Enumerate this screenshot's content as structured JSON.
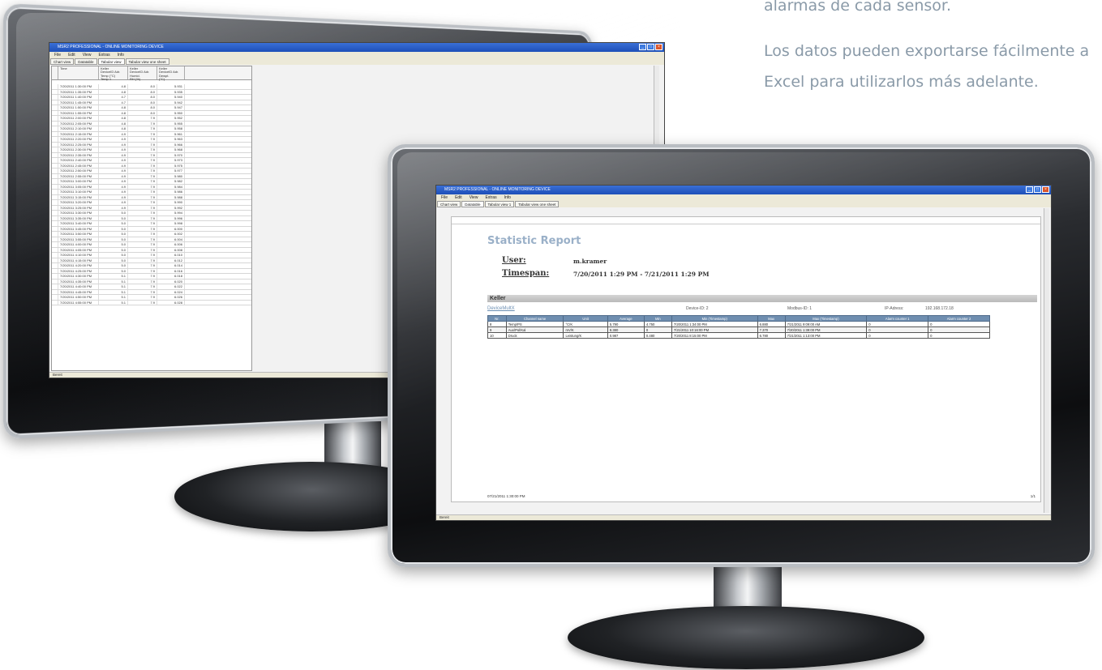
{
  "copy": {
    "line1": "alarmas de cada sensor.",
    "line2": "Los datos pueden exportarse fácilmente a",
    "line3": "Excel para utilizarlos más adelante."
  },
  "window": {
    "title": "MSR2 PROFESSIONAL - ONLINE MONITORING DEVICE",
    "menu": [
      "File",
      "Edit",
      "View",
      "Extras",
      "Info"
    ],
    "status": "Bereit"
  },
  "left_screen": {
    "tabs": [
      "Chart view",
      "Datatable",
      "Tabular view",
      "Tabular view one sheet"
    ],
    "active_tab": 2,
    "columns": [
      "Time",
      "Keller\nDeviceID Adr.\nTemp (°C)\nTemp 1",
      "Keller\nDeviceID Adr.\nHumid.\nRH (%)",
      "Keller\nDeviceID Adr.\nDewpt.\n(°C)"
    ],
    "rows": [
      [
        "7/20/2011 1:30:00 PM",
        "4.8",
        "8.0",
        "5.931"
      ],
      [
        "7/20/2011 1:35:00 PM",
        "4.8",
        "8.0",
        "5.935"
      ],
      [
        "7/20/2011 1:40:00 PM",
        "4.7",
        "8.0",
        "5.940"
      ],
      [
        "7/20/2011 1:45:00 PM",
        "4.7",
        "8.0",
        "5.942"
      ],
      [
        "7/20/2011 1:50:00 PM",
        "4.8",
        "8.0",
        "5.947"
      ],
      [
        "7/20/2011 1:55:00 PM",
        "4.8",
        "8.0",
        "5.950"
      ],
      [
        "7/20/2011 2:00:00 PM",
        "4.8",
        "7.9",
        "5.952"
      ],
      [
        "7/20/2011 2:05:00 PM",
        "4.8",
        "7.9",
        "5.955"
      ],
      [
        "7/20/2011 2:10:00 PM",
        "4.8",
        "7.9",
        "5.958"
      ],
      [
        "7/20/2011 2:15:00 PM",
        "4.9",
        "7.9",
        "5.961"
      ],
      [
        "7/20/2011 2:20:00 PM",
        "4.9",
        "7.9",
        "5.963"
      ],
      [
        "7/20/2011 2:25:00 PM",
        "4.9",
        "7.9",
        "5.966"
      ],
      [
        "7/20/2011 2:30:00 PM",
        "4.9",
        "7.9",
        "5.968"
      ],
      [
        "7/20/2011 2:35:00 PM",
        "4.9",
        "7.9",
        "5.970"
      ],
      [
        "7/20/2011 2:40:00 PM",
        "4.9",
        "7.9",
        "5.973"
      ],
      [
        "7/20/2011 2:45:00 PM",
        "4.9",
        "7.9",
        "5.975"
      ],
      [
        "7/20/2011 2:50:00 PM",
        "4.9",
        "7.9",
        "5.977"
      ],
      [
        "7/20/2011 2:55:00 PM",
        "4.9",
        "7.9",
        "5.980"
      ],
      [
        "7/20/2011 3:00:00 PM",
        "4.9",
        "7.9",
        "5.982"
      ],
      [
        "7/20/2011 3:05:00 PM",
        "4.9",
        "7.9",
        "5.984"
      ],
      [
        "7/20/2011 3:10:00 PM",
        "4.9",
        "7.9",
        "5.986"
      ],
      [
        "7/20/2011 3:15:00 PM",
        "4.9",
        "7.9",
        "5.988"
      ],
      [
        "7/20/2011 3:20:00 PM",
        "4.9",
        "7.9",
        "5.990"
      ],
      [
        "7/20/2011 3:25:00 PM",
        "4.9",
        "7.9",
        "5.992"
      ],
      [
        "7/20/2011 3:30:00 PM",
        "5.0",
        "7.9",
        "5.994"
      ],
      [
        "7/20/2011 3:35:00 PM",
        "5.0",
        "7.9",
        "5.996"
      ],
      [
        "7/20/2011 3:40:00 PM",
        "5.0",
        "7.9",
        "5.998"
      ],
      [
        "7/20/2011 3:45:00 PM",
        "5.0",
        "7.9",
        "6.000"
      ],
      [
        "7/20/2011 3:50:00 PM",
        "5.0",
        "7.9",
        "6.002"
      ],
      [
        "7/20/2011 3:55:00 PM",
        "5.0",
        "7.9",
        "6.004"
      ],
      [
        "7/20/2011 4:00:00 PM",
        "5.0",
        "7.9",
        "6.006"
      ],
      [
        "7/20/2011 4:05:00 PM",
        "5.0",
        "7.9",
        "6.008"
      ],
      [
        "7/20/2011 4:10:00 PM",
        "5.0",
        "7.9",
        "6.010"
      ],
      [
        "7/20/2011 4:15:00 PM",
        "5.0",
        "7.9",
        "6.012"
      ],
      [
        "7/20/2011 4:20:00 PM",
        "5.0",
        "7.9",
        "6.014"
      ],
      [
        "7/20/2011 4:25:00 PM",
        "5.0",
        "7.9",
        "6.016"
      ],
      [
        "7/20/2011 4:30:00 PM",
        "5.1",
        "7.9",
        "6.018"
      ],
      [
        "7/20/2011 4:35:00 PM",
        "5.1",
        "7.9",
        "6.020"
      ],
      [
        "7/20/2011 4:40:00 PM",
        "5.1",
        "7.9",
        "6.022"
      ],
      [
        "7/20/2011 4:45:00 PM",
        "5.1",
        "7.9",
        "6.024"
      ],
      [
        "7/20/2011 4:50:00 PM",
        "5.1",
        "7.9",
        "6.026"
      ],
      [
        "7/20/2011 4:55:00 PM",
        "5.1",
        "7.9",
        "6.028"
      ]
    ]
  },
  "right_screen": {
    "tabs": [
      "Chart view",
      "Datatable",
      "Tabular view 1",
      "Tabular view one sheet"
    ],
    "active_tab": 1,
    "report_title": "Statistic Report",
    "user_label": "User:",
    "user_value": "m.kramer",
    "timespan_label": "Timespan:",
    "timespan_value": "7/20/2011 1:29 PM - 7/21/2011 1:29 PM",
    "section": "Keller",
    "device_name": "DeviceMultX",
    "device_id": "Device-ID: 2",
    "modbus_id": "Modbus-ID: 1",
    "ip_label": "IP-Adress:",
    "ip_value": "192.168.172.18",
    "columns": [
      "Nr.",
      "Channel name",
      "Unit",
      "Average",
      "Min",
      "Min (Timestamp)",
      "Max",
      "Max (Timestamp)",
      "Alarm counter 1",
      "Alarm counter 2"
    ],
    "rows": [
      [
        "8",
        "Temp/PS",
        "°C/K",
        "5.790",
        "4.750",
        "7/20/2011 1:34:00 PM",
        "6.880",
        "7/21/2011 9:09:00 AM",
        "0",
        "0"
      ],
      [
        "9",
        "Aux/Pol/Kal",
        "mV/K",
        "8.380",
        "0",
        "7/21/2011 10:16:00 PM",
        "7.370",
        "7/20/2011 1:39:00 PM",
        "0",
        "0"
      ],
      [
        "10",
        "Druck",
        "Leistung/K",
        "0.987",
        "0.480",
        "7/20/2011 8:15:00 PM",
        "6.780",
        "7/21/2011 1:13:00 PM",
        "0",
        "0"
      ]
    ],
    "footer_date": "07/21/2011 1:30:00 PM",
    "page": "1/1"
  }
}
